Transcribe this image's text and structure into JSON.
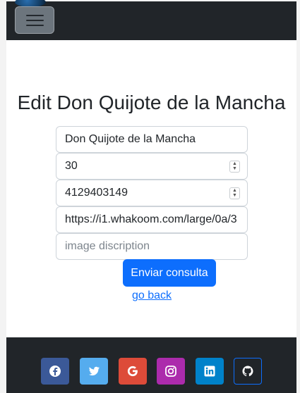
{
  "page": {
    "title": "Edit Don Quijote de la Mancha"
  },
  "navbar": {
    "toggle_icon": "hamburger-menu-icon"
  },
  "form": {
    "name_value": "Don Quijote de la Mancha",
    "age_value": "30",
    "phone_value": "4129403149",
    "image_url_value": "https://i1.whakoom.com/large/0a/3",
    "image_description_placeholder": "image discription",
    "submit_label": "Enviar consulta",
    "back_label": "go back"
  },
  "footer": {
    "social": [
      {
        "name": "facebook",
        "icon": "facebook-icon",
        "color": "#3b5998"
      },
      {
        "name": "twitter",
        "icon": "twitter-icon",
        "color": "#55acee"
      },
      {
        "name": "google",
        "icon": "google-icon",
        "color": "#dd4b39"
      },
      {
        "name": "instagram",
        "icon": "instagram-icon",
        "color": "#ac2bac"
      },
      {
        "name": "linkedin",
        "icon": "linkedin-icon",
        "color": "#0082ca"
      },
      {
        "name": "github",
        "icon": "github-icon",
        "color": "#333333"
      }
    ]
  },
  "colors": {
    "navbar_bg": "#212529",
    "primary": "#0d6efd"
  }
}
